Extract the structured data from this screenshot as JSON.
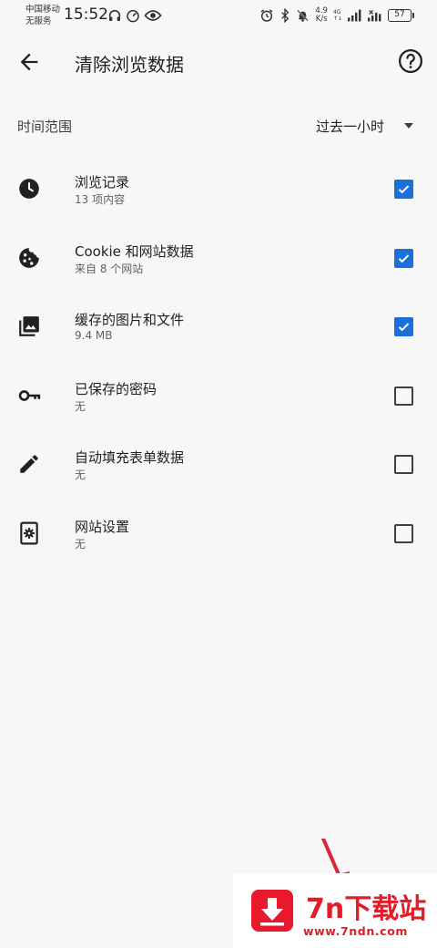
{
  "status_bar": {
    "carrier_1": "中国移动",
    "carrier_2": "无服务",
    "time": "15:52",
    "speed_value": "4.9",
    "speed_unit": "K/s",
    "network_top": "4G",
    "network_bottom": "↑↓",
    "battery": "57"
  },
  "toolbar": {
    "title": "清除浏览数据",
    "back_icon": "arrow-left-icon",
    "help_icon": "help-circle-icon"
  },
  "time_range": {
    "label": "时间范围",
    "value": "过去一小时"
  },
  "options": [
    {
      "title": "浏览记录",
      "subtitle": "13 项内容",
      "icon": "clock-icon",
      "checked": true
    },
    {
      "title": "Cookie 和网站数据",
      "subtitle": "来自 8 个网站",
      "icon": "cookie-icon",
      "checked": true
    },
    {
      "title": "缓存的图片和文件",
      "subtitle": "9.4 MB",
      "icon": "images-icon",
      "checked": true
    },
    {
      "title": "已保存的密码",
      "subtitle": "无",
      "icon": "key-icon",
      "checked": false
    },
    {
      "title": "自动填充表单数据",
      "subtitle": "无",
      "icon": "pencil-icon",
      "checked": false
    },
    {
      "title": "网站设置",
      "subtitle": "无",
      "icon": "site-settings-icon",
      "checked": false
    }
  ],
  "watermark": {
    "name": "7n下载站",
    "url": "www.7ndn.com"
  },
  "colors": {
    "accent": "#1a6fd8",
    "watermark_red": "#e11d2a",
    "background": "#f7f7f7"
  }
}
